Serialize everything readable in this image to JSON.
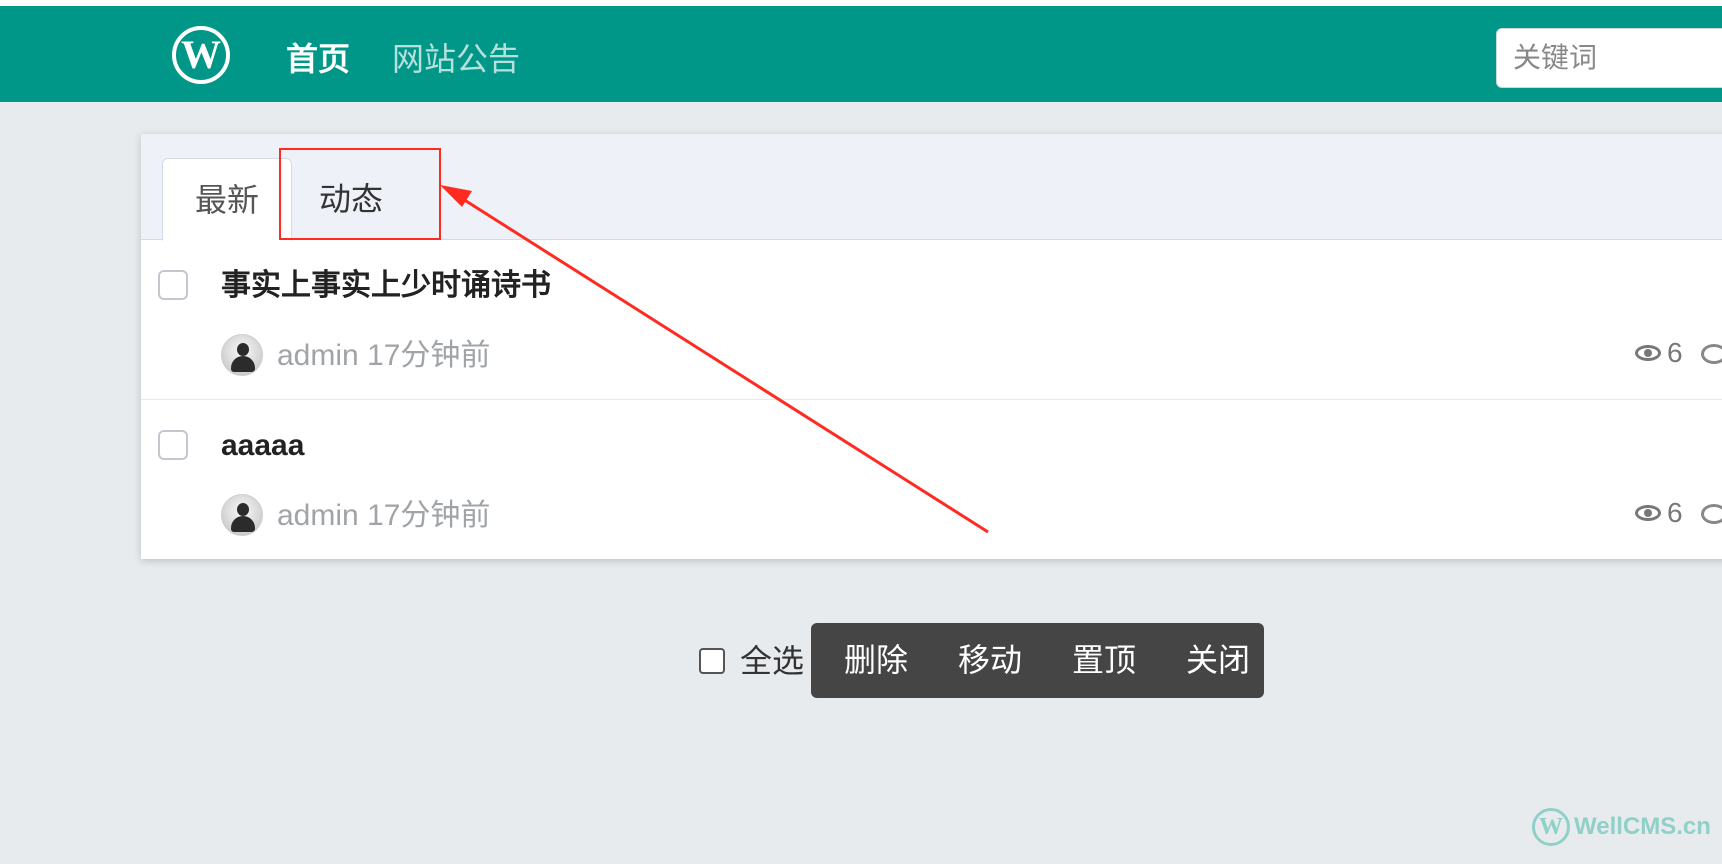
{
  "navbar": {
    "logo_letter": "W",
    "links": [
      "首页",
      "网站公告"
    ],
    "search_placeholder": "关键词"
  },
  "tabs": [
    "最新",
    "动态"
  ],
  "threads": [
    {
      "title": "事实上事实上少时诵诗书",
      "author": "admin",
      "time": "17分钟前",
      "views": "6"
    },
    {
      "title": "aaaaa",
      "author": "admin",
      "time": "17分钟前",
      "views": "6"
    }
  ],
  "bulk_actions": {
    "select_all": "全选",
    "buttons": [
      "删除",
      "移动",
      "置顶",
      "关闭"
    ]
  },
  "watermark": {
    "logo_letter": "W",
    "text": "WellCMS.cn"
  },
  "annotation": {
    "color": "#ff2a20"
  },
  "colors": {
    "navbar": "#009688",
    "action_bar": "#454545"
  }
}
